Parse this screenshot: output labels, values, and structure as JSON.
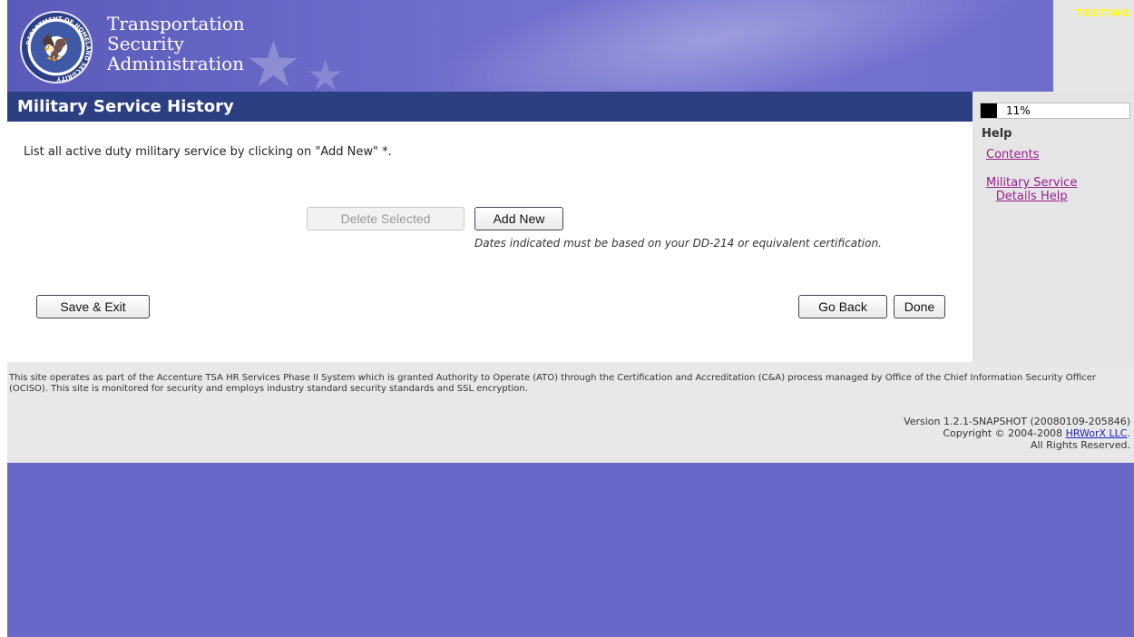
{
  "header": {
    "agency_line1": "Transportation",
    "agency_line2": "Security",
    "agency_line3": "Administration",
    "environment_label": "TESTING",
    "seal_text": "DEPARTMENT OF HOMELAND SECURITY"
  },
  "page": {
    "title": "Military Service History"
  },
  "progress": {
    "percent": 11,
    "label": "11%"
  },
  "help": {
    "heading": "Help",
    "links": [
      {
        "label": "Contents"
      },
      {
        "label_line1": "Military Service",
        "label_line2": "Details Help"
      }
    ]
  },
  "main": {
    "instructions": "List all active duty military service by clicking on \"Add New\" *.",
    "delete_button": "Delete Selected",
    "add_button": "Add New",
    "note": "Dates indicated must be based on your DD-214 or equivalent certification.",
    "save_exit_button": "Save & Exit",
    "go_back_button": "Go Back",
    "done_button": "Done"
  },
  "footer": {
    "notice": "This site operates as part of the Accenture TSA HR Services Phase II System which is granted Authority to Operate (ATO) through the Certification and Accreditation (C&A) process managed by Office of the Chief Information Security Officer (OCISO). This site is monitored for security and employs industry standard security standards and SSL encryption.",
    "version": "Version 1.2.1-SNAPSHOT (20080109-205846)",
    "copyright_prefix": "Copyright © 2004-2008 ",
    "company_link": "HRWorX LLC",
    "copyright_suffix": ".",
    "rights": "All Rights Reserved."
  },
  "colors": {
    "header_bg": "#6a6ac9",
    "title_bar": "#2c3f83",
    "testing_label": "#ffff00",
    "help_link": "#9a1f8f",
    "page_bg": "#6868c8"
  }
}
